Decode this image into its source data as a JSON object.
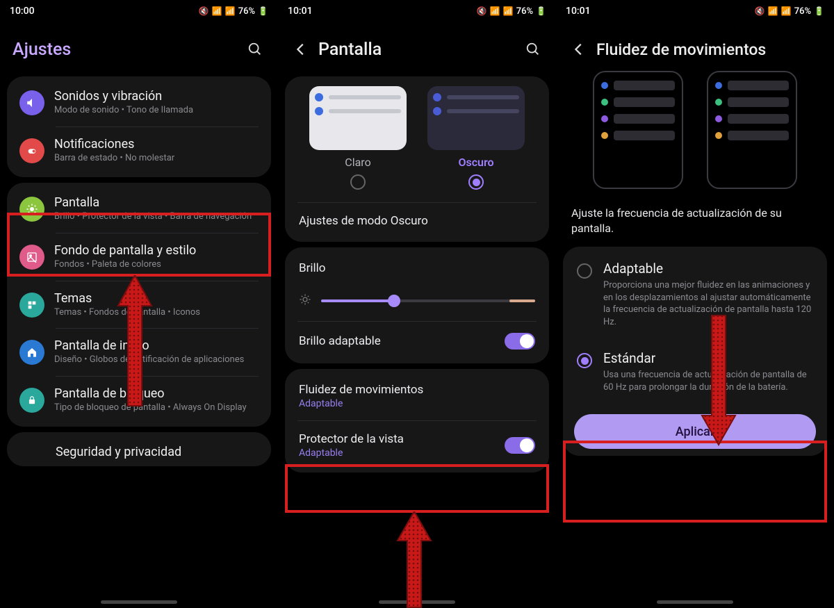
{
  "status": {
    "battery": "76%"
  },
  "screen1": {
    "time": "10:00",
    "title": "Ajustes",
    "items": {
      "sounds": {
        "title": "Sonidos y vibración",
        "sub": "Modo de sonido  •  Tono de llamada"
      },
      "notifs": {
        "title": "Notificaciones",
        "sub": "Barra de estado  •  No molestar"
      },
      "display": {
        "title": "Pantalla",
        "sub": "Brillo  •  Protector de la vista  •  Barra de navegación"
      },
      "wallpaper": {
        "title": "Fondo de pantalla y estilo",
        "sub": "Fondos  •  Paleta de colores"
      },
      "themes": {
        "title": "Temas",
        "sub": "Temas  •  Fondos de pantalla  •  Iconos"
      },
      "home": {
        "title": "Pantalla de inicio",
        "sub": "Diseño  •  Globos de notificación de aplicaciones"
      },
      "lock": {
        "title": "Pantalla de bloqueo",
        "sub": "Tipo de bloqueo de pantalla  •  Always On Display"
      },
      "security": {
        "title": "Seguridad y privacidad"
      }
    }
  },
  "screen2": {
    "time": "10:01",
    "title": "Pantalla",
    "theme": {
      "light": "Claro",
      "dark": "Oscuro",
      "darkSettings": "Ajustes de modo Oscuro"
    },
    "brightness": {
      "title": "Brillo",
      "adaptive": "Brillo adaptable"
    },
    "motion": {
      "title": "Fluidez de movimientos",
      "value": "Adaptable"
    },
    "eye": {
      "title": "Protector de la vista",
      "value": "Adaptable"
    }
  },
  "screen3": {
    "time": "10:01",
    "title": "Fluidez de movimientos",
    "instruction": "Ajuste la frecuencia de actualización de su pantalla.",
    "adaptive": {
      "title": "Adaptable",
      "desc": "Proporciona una mejor fluidez en las animaciones y en los desplazamientos al ajustar automáticamente la frecuencia de actualización de pantalla hasta 120 Hz."
    },
    "standard": {
      "title": "Estándar",
      "desc": "Usa una frecuencia de actualización de pantalla de 60 Hz para prolongar la duración de la batería."
    },
    "apply": "Aplicar"
  }
}
